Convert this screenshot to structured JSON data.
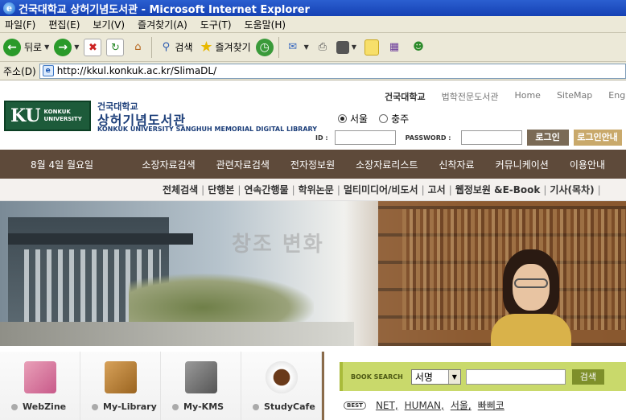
{
  "window": {
    "title": "건국대학교 상허기념도서관 - Microsoft Internet Explorer"
  },
  "menubar": {
    "items": [
      "파일(F)",
      "편집(E)",
      "보기(V)",
      "즐겨찾기(A)",
      "도구(T)",
      "도움말(H)"
    ]
  },
  "toolbar": {
    "back_label": "뒤로",
    "search_label": "검색",
    "favorites_label": "즐겨찾기"
  },
  "address": {
    "label": "주소(D)",
    "url": "http://kkul.konkuk.ac.kr/SlimaDL/"
  },
  "header": {
    "logo_ku": "KU",
    "logo_sub1": "KONKUK",
    "logo_sub2": "UNIVERSITY",
    "lib_top": "건국대학교",
    "lib_name": "상허기념도서관",
    "lib_eng": "KONKUK UNIVERSITY SANGHUH MEMORIAL DIGITAL LIBRARY",
    "top_links": [
      "건국대학교",
      "법학전문도서관",
      "Home",
      "SiteMap",
      "Engl"
    ],
    "campus": [
      "서울",
      "충주"
    ],
    "id_label": "ID :",
    "pw_label": "PASSWORD :",
    "login_btn": "로그인",
    "login_help_btn": "로그인안내"
  },
  "navbar": {
    "date": "8월 4일 월요일",
    "items": [
      "소장자료검색",
      "관련자료검색",
      "전자정보원",
      "소장자료리스트",
      "신착자료",
      "커뮤니케이션",
      "이용안내"
    ]
  },
  "subnav": {
    "items": [
      "전체검색",
      "단행본",
      "연속간행물",
      "학위논문",
      "멀티미디어/비도서",
      "고서",
      "웹정보원 &E-Book",
      "기사(목차)"
    ]
  },
  "banner": {
    "text": "창조 변화"
  },
  "quick": {
    "items": [
      "WebZine",
      "My-Library",
      "My-KMS",
      "StudyCafe"
    ]
  },
  "search": {
    "label": "BOOK SEARCH",
    "select_value": "서명",
    "button": "검색",
    "best_badge": "BEST",
    "best_keywords": [
      "NET,",
      "HUMAN,",
      "서울,",
      "빠삐코"
    ]
  },
  "colors": {
    "nav_bg": "#5e4a3a",
    "logo_bg": "#1d5b3a",
    "search_bg": "#c9d96b"
  }
}
